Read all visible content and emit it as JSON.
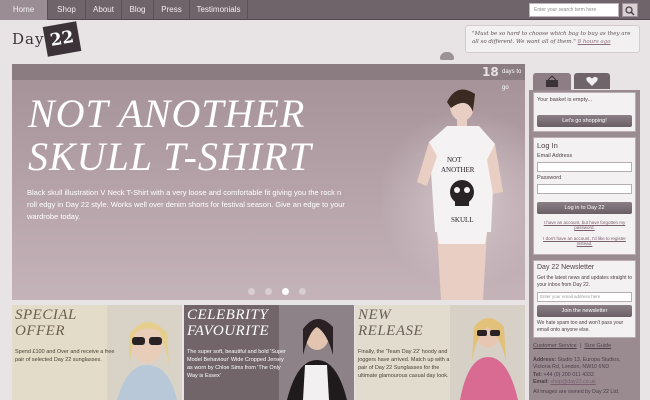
{
  "nav": {
    "items": [
      "Home",
      "Shop",
      "About",
      "Blog",
      "Press",
      "Testimonials"
    ],
    "active": "Home",
    "search_placeholder": "Enter your search term here"
  },
  "logo": {
    "text": "Day",
    "mark": "22"
  },
  "quote": {
    "text": "\"Must be so hard to choose which bag to buy as they are all so different. We want all of them.\"",
    "time": "8 hours ago"
  },
  "hero": {
    "days_number": "18",
    "days_label": "days to go",
    "headline_line1": "NOT ANOTHER",
    "headline_line2": "SKULL T-SHIRT",
    "description": "Black skull illustration V Neck T-Shirt with a very loose and comfortable fit giving you the rock n roll edgy in Day 22 style. Works well over denim shorts for festival season. Give an edge to your wardrobe today.",
    "shirt_text": "NOT ANOTHER SKULL",
    "slides_total": 4,
    "slide_active_index": 2
  },
  "promos": [
    {
      "title_line1": "SPECIAL",
      "title_line2": "OFFER",
      "text": "Spend £100 and Over and receive a free pair of selected Day 22 sunglasses."
    },
    {
      "title_line1": "CELEBRITY",
      "title_line2": "FAVOURITE",
      "text": "The super soft, beautiful and bold 'Super Model Behaviour' Wide Cropped Jersey as worn by Chloe Sims from 'The Only Way is Essex'"
    },
    {
      "title_line1": "NEW",
      "title_line2": "RELEASE",
      "text": "Finally, the 'Team Day 22' hoody and joggers have arrived. Match up with a pair of Day 22 Sunglasses for the ultimate glamourous casual day look."
    }
  ],
  "basket": {
    "text": "Your basket is empty...",
    "button": "Let's go shopping!"
  },
  "login": {
    "title": "Log In",
    "email_label": "Email Address",
    "password_label": "Password",
    "button": "Log in to Day 22",
    "forgot": "I have an account, but have forgotten my password.",
    "register": "I don't have an account, I'd like to register instead."
  },
  "newsletter": {
    "title": "Day 22 Newsletter",
    "text": "Get the latest news and updates straight to your inbox from Day 22.",
    "placeholder": "Enter your email address here",
    "button": "Join the newsletter",
    "note": "We hate spam too and won't pass your email onto anyone else."
  },
  "footer": {
    "customer_service": "Customer Service",
    "size_guide": "Size Guide",
    "address_label": "Address:",
    "address": "Studio 13, Europa Studios, Victoria Rd, London, NW10 6ND",
    "tel_label": "Tel:",
    "tel": "+44 (0) 200 011 4332",
    "email_label": "Email:",
    "email": "shop@day22.co.uk",
    "copyright": "All images are owned by Day 22 Ltd."
  },
  "colors": {
    "nav": "#6f646a",
    "hero": "#b3a0a7",
    "accent": "#8a6f7c"
  }
}
